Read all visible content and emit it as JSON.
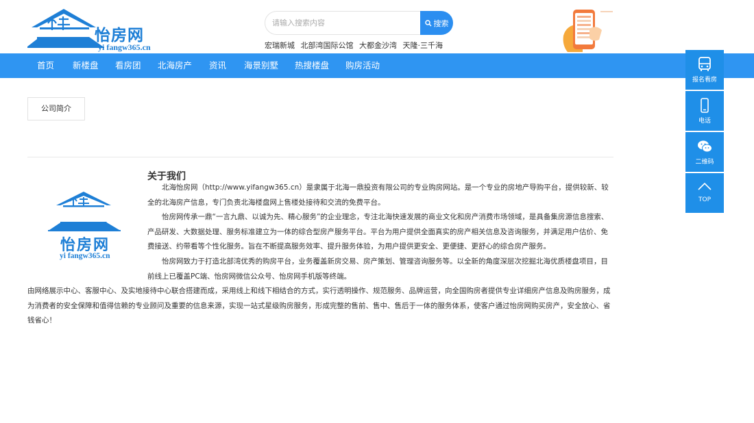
{
  "header": {
    "logo_text_cn": "怡房网",
    "logo_text_en": "yi fangw365.cn",
    "search": {
      "placeholder": "请输入搜索内容",
      "button_label": "搜索"
    },
    "hot_links": [
      "宏瑞新城",
      "北部湾国际公馆",
      "大都金沙湾",
      "天隆·三千海"
    ]
  },
  "nav": {
    "items": [
      "首页",
      "新楼盘",
      "看房团",
      "北海房产",
      "资讯",
      "海景别墅",
      "热搜楼盘",
      "购房活动"
    ]
  },
  "tab": {
    "label": "公司简介"
  },
  "about": {
    "title": "关于我们",
    "logo_text_cn": "怡房网",
    "logo_text_en": "yi fangw365.cn",
    "paragraphs": [
      "北海怡房网（http://www.yifangw365.cn）是隶属于北海一鼎投资有限公司的专业购房网站。是一个专业的房地产导购平台，提供较新、较全的北海房产信息，专门负责北海楼盘网上售楼处接待和交流的免费平台。",
      "怡房网传承一鼎“一言九鼎、以诚为先、精心服务”的企业理念，专注北海快速发展的商业文化和房产消费市场领域，是具备集房源信息搜索、产品研发、大数据处理、服务标准建立为一体的综合型房产服务平台。平台为用户提供全面真实的房产相关信息及咨询服务，并满足用户估价、免费接送、约带看等个性化服务。旨在不断提高服务效率、提升服务体验，为用户提供更安全、更便捷、更舒心的综合房产服务。",
      "怡房网致力于打造北部湾优秀的购房平台，业务覆盖新房交易、房产策划、管理咨询服务等。以全新的角度深层次挖掘北海优质楼盘项目，目前线上已覆盖PC端、怡房网微信公众号、怡房网手机版等终端。",
      "由网络展示中心、客服中心、及实地接待中心联合搭建而成，采用线上和线下相结合的方式，实行透明操作、规范服务、品牌运营，向全国购房者提供专业详细房产信息及购房服务，成为消费者的安全保障和值得信赖的专业顾问及重要的信息来源，实现一站式星级购房服务，形成完整的售前、售中、售后于一体的服务体系，使客户通过怡房网购买房产，安全放心、省钱省心！"
    ]
  },
  "sidebar": {
    "items": [
      {
        "label": "报名看房",
        "icon": "bus-icon"
      },
      {
        "label": "电话",
        "icon": "phone-icon"
      },
      {
        "label": "二维码",
        "icon": "wechat-icon"
      },
      {
        "label": "TOP",
        "icon": "arrow-up-icon"
      }
    ]
  },
  "colors": {
    "brand_blue": "#2f95f2",
    "sidebar_blue": "#1f8fe8",
    "logo_blue": "#1e7fd6"
  }
}
